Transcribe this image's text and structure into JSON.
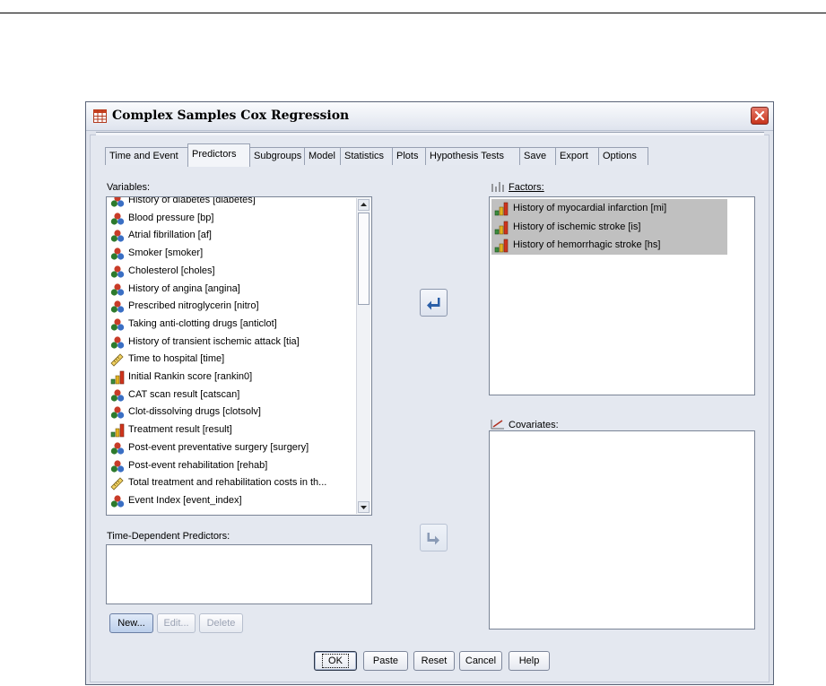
{
  "dialog": {
    "title": "Complex Samples Cox Regression",
    "tabs": [
      "Time and Event",
      "Predictors",
      "Subgroups",
      "Model",
      "Statistics",
      "Plots",
      "Hypothesis Tests",
      "Save",
      "Export",
      "Options"
    ],
    "active_tab": "Predictors"
  },
  "variables": {
    "label": "Variables:",
    "items": [
      {
        "label": "History of diabetes [diabetes]",
        "icon": "nominal-icon"
      },
      {
        "label": "Blood pressure [bp]",
        "icon": "nominal-icon"
      },
      {
        "label": "Atrial fibrillation [af]",
        "icon": "nominal-icon"
      },
      {
        "label": "Smoker [smoker]",
        "icon": "nominal-icon"
      },
      {
        "label": "Cholesterol [choles]",
        "icon": "nominal-icon"
      },
      {
        "label": "History of angina [angina]",
        "icon": "nominal-icon"
      },
      {
        "label": "Prescribed nitroglycerin [nitro]",
        "icon": "nominal-icon"
      },
      {
        "label": "Taking anti-clotting drugs [anticlot]",
        "icon": "nominal-icon"
      },
      {
        "label": "History of transient ischemic attack [tia]",
        "icon": "nominal-icon"
      },
      {
        "label": "Time to hospital [time]",
        "icon": "scale-icon"
      },
      {
        "label": "Initial Rankin score [rankin0]",
        "icon": "ordinal-icon"
      },
      {
        "label": "CAT scan result [catscan]",
        "icon": "nominal-icon"
      },
      {
        "label": "Clot-dissolving drugs [clotsolv]",
        "icon": "nominal-icon"
      },
      {
        "label": "Treatment result [result]",
        "icon": "ordinal-icon"
      },
      {
        "label": "Post-event preventative surgery [surgery]",
        "icon": "nominal-icon"
      },
      {
        "label": "Post-event rehabilitation [rehab]",
        "icon": "nominal-icon"
      },
      {
        "label": "Total treatment and rehabilitation costs in th...",
        "icon": "scale-icon"
      },
      {
        "label": "Event Index [event_index]",
        "icon": "nominal-icon"
      }
    ]
  },
  "factors": {
    "label": "Factors:",
    "items": [
      {
        "label": "History of myocardial infarction [mi]",
        "icon": "ordinal-icon"
      },
      {
        "label": "History of ischemic stroke [is]",
        "icon": "ordinal-icon"
      },
      {
        "label": "History of hemorrhagic stroke [hs]",
        "icon": "ordinal-icon"
      }
    ]
  },
  "covariates": {
    "label": "Covariates:"
  },
  "time_dependent": {
    "label": "Time-Dependent Predictors:"
  },
  "predictor_buttons": {
    "new": "New...",
    "edit": "Edit...",
    "delete": "Delete"
  },
  "footer_buttons": {
    "ok": "OK",
    "paste": "Paste",
    "reset": "Reset",
    "cancel": "Cancel",
    "help": "Help"
  }
}
